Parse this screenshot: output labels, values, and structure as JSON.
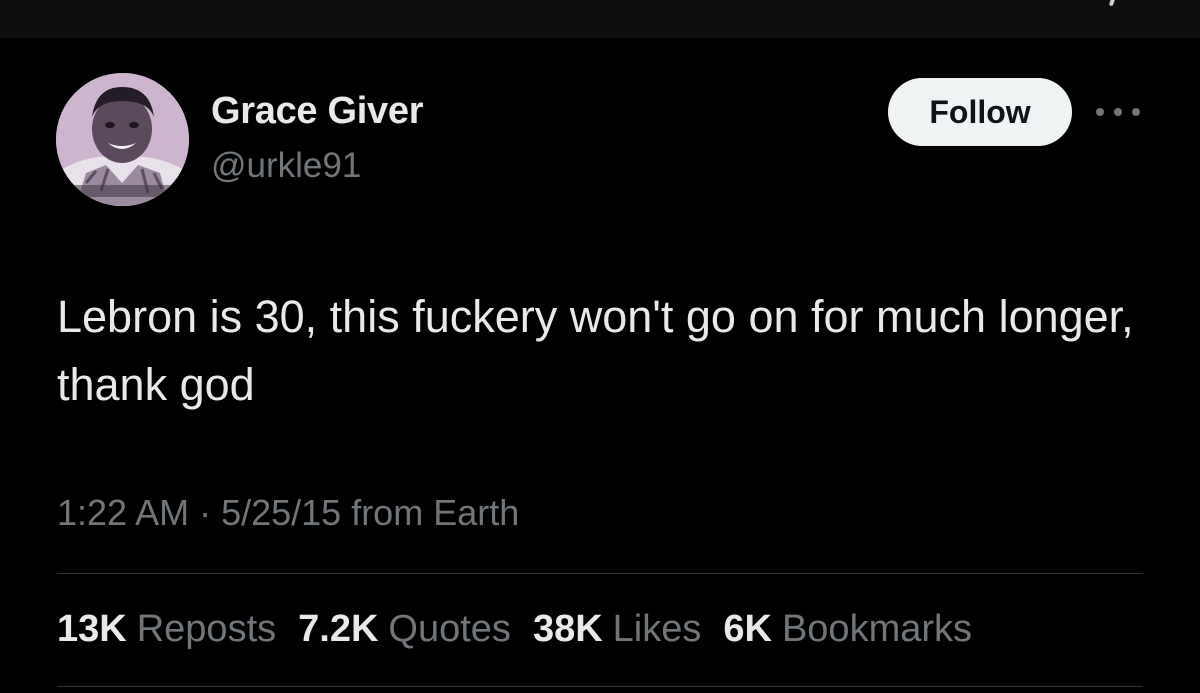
{
  "author": {
    "name": "Grace Giver",
    "handle": "@urkle91"
  },
  "actions": {
    "follow_label": "Follow",
    "more_icon": "more-dots-icon"
  },
  "tweet": {
    "text": "Lebron is 30, this fuckery won't go on for much longer, thank god",
    "meta": "1:22 AM · 5/25/15 from Earth"
  },
  "stats": [
    {
      "count": "13K",
      "label": "Reposts"
    },
    {
      "count": "7.2K",
      "label": "Quotes"
    },
    {
      "count": "38K",
      "label": "Likes"
    },
    {
      "count": "6K",
      "label": "Bookmarks"
    }
  ],
  "colors": {
    "background": "#000000",
    "primary_text": "#e7e9ea",
    "secondary_text": "#71767b",
    "follow_bg": "#eff3f4",
    "divider": "#2f3336",
    "avatar_tint": "#cdb5cf"
  }
}
